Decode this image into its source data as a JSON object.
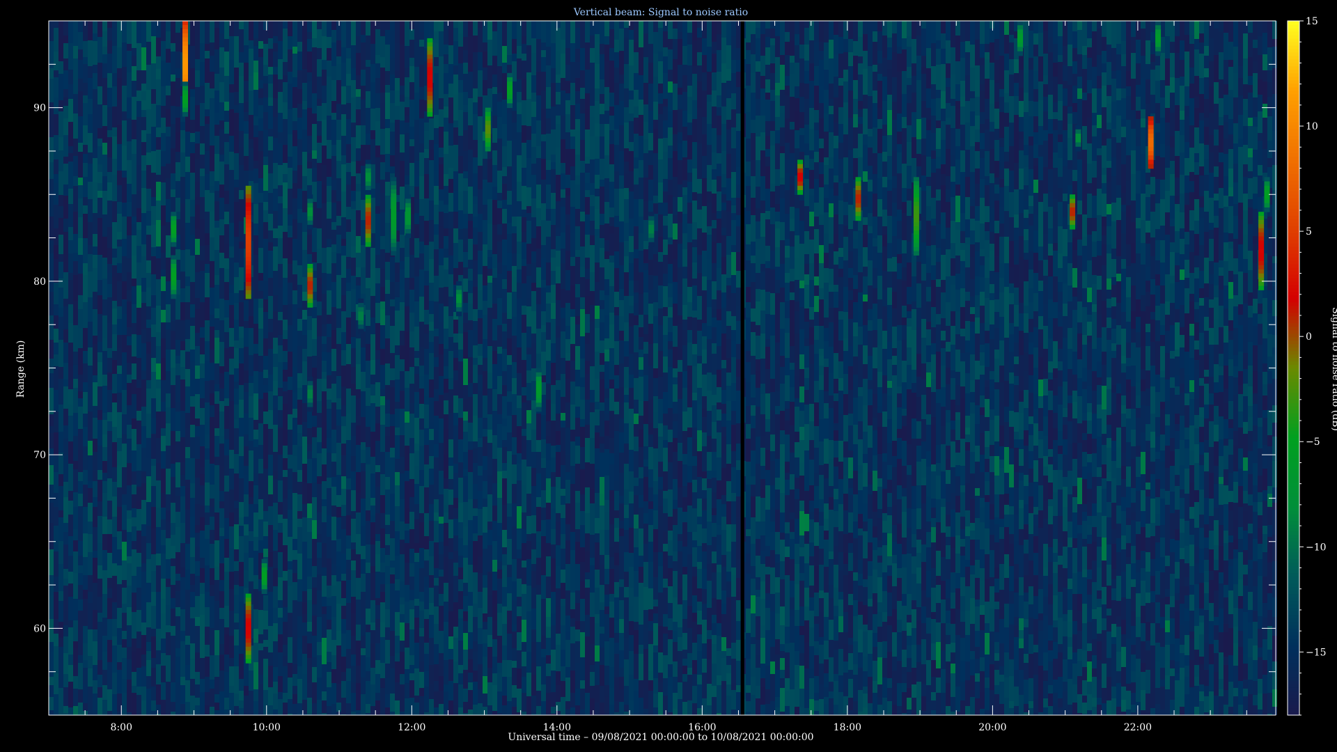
{
  "chart_data": {
    "type": "heatmap",
    "title": "Vertical beam: Signal to noise ratio",
    "xlabel": "Universal time – 09/08/2021 00:00:00 to 10/08/2021 00:00:00",
    "ylabel": "Range (km)",
    "colorbar_label": "Signal to noise ratio (dB)",
    "x_unit": "hours UT",
    "xlim": [
      7.0,
      23.9
    ],
    "ylim": [
      55.0,
      95.0
    ],
    "clim": [
      -18.0,
      15.0
    ],
    "x_ticks": [
      8,
      10,
      12,
      14,
      16,
      18,
      20,
      22
    ],
    "x_tick_labels": [
      "8:00",
      "10:00",
      "12:00",
      "14:00",
      "16:00",
      "18:00",
      "20:00",
      "22:00"
    ],
    "y_ticks": [
      60,
      70,
      80,
      90
    ],
    "y_tick_labels": [
      "60",
      "70",
      "80",
      "90"
    ],
    "colorbar_ticks": [
      15,
      10,
      5,
      0,
      -5,
      -10,
      -15
    ],
    "colorbar_tick_labels": [
      "15",
      "10",
      "5",
      "0",
      "−5",
      "−10",
      "−15"
    ],
    "colormap": [
      "#1a1a4d",
      "#00305c",
      "#005a5a",
      "#008f3a",
      "#00a020",
      "#6a8a00",
      "#d40000",
      "#e04000",
      "#f07000",
      "#ffa000",
      "#ffff20"
    ],
    "background_snr": -16,
    "data_gap": {
      "start": 16.53,
      "end": 16.58
    },
    "echoes": [
      {
        "time": 8.88,
        "range_min": 90.0,
        "range_max": 95.0,
        "snr": 11
      },
      {
        "time": 8.88,
        "range_min": 89.5,
        "range_max": 91.5,
        "snr": -5
      },
      {
        "time": 8.72,
        "range_min": 82.0,
        "range_max": 84.0,
        "snr": -5
      },
      {
        "time": 8.72,
        "range_min": 79.0,
        "range_max": 81.5,
        "snr": -5
      },
      {
        "time": 9.75,
        "range_min": 79.0,
        "range_max": 85.5,
        "snr": 5
      },
      {
        "time": 9.75,
        "range_min": 58.0,
        "range_max": 62.0,
        "snr": 2
      },
      {
        "time": 9.97,
        "range_min": 62.0,
        "range_max": 64.0,
        "snr": -5
      },
      {
        "time": 10.6,
        "range_min": 78.5,
        "range_max": 81.0,
        "snr": 1
      },
      {
        "time": 10.6,
        "range_min": 83.0,
        "range_max": 85.0,
        "snr": -8
      },
      {
        "time": 10.6,
        "range_min": 72.5,
        "range_max": 74.5,
        "snr": -9
      },
      {
        "time": 11.4,
        "range_min": 82.0,
        "range_max": 85.0,
        "snr": 1
      },
      {
        "time": 11.4,
        "range_min": 85.0,
        "range_max": 87.0,
        "snr": -8
      },
      {
        "time": 11.75,
        "range_min": 81.5,
        "range_max": 86.0,
        "snr": -6
      },
      {
        "time": 11.95,
        "range_min": 82.5,
        "range_max": 85.0,
        "snr": -7
      },
      {
        "time": 11.3,
        "range_min": 77.0,
        "range_max": 79.0,
        "snr": -9
      },
      {
        "time": 12.25,
        "range_min": 89.5,
        "range_max": 94.0,
        "snr": 2
      },
      {
        "time": 12.65,
        "range_min": 78.0,
        "range_max": 80.0,
        "snr": -8
      },
      {
        "time": 13.05,
        "range_min": 87.5,
        "range_max": 90.0,
        "snr": -2
      },
      {
        "time": 13.35,
        "range_min": 90.0,
        "range_max": 92.0,
        "snr": -5
      },
      {
        "time": 13.75,
        "range_min": 72.5,
        "range_max": 75.0,
        "snr": -6
      },
      {
        "time": 15.3,
        "range_min": 82.0,
        "range_max": 84.0,
        "snr": -9
      },
      {
        "time": 17.35,
        "range_min": 85.0,
        "range_max": 87.0,
        "snr": 2
      },
      {
        "time": 18.15,
        "range_min": 83.5,
        "range_max": 86.0,
        "snr": 1
      },
      {
        "time": 18.95,
        "range_min": 81.5,
        "range_max": 86.0,
        "snr": -3
      },
      {
        "time": 20.38,
        "range_min": 93.0,
        "range_max": 95.0,
        "snr": -6
      },
      {
        "time": 21.1,
        "range_min": 83.0,
        "range_max": 85.0,
        "snr": 1
      },
      {
        "time": 21.18,
        "range_min": 87.5,
        "range_max": 89.0,
        "snr": -8
      },
      {
        "time": 22.18,
        "range_min": 86.5,
        "range_max": 89.5,
        "snr": 8
      },
      {
        "time": 22.28,
        "range_min": 93.0,
        "range_max": 95.0,
        "snr": -6
      },
      {
        "time": 23.7,
        "range_min": 79.5,
        "range_max": 84.0,
        "snr": 2
      },
      {
        "time": 23.78,
        "range_min": 84.0,
        "range_max": 86.0,
        "snr": -5
      }
    ]
  }
}
